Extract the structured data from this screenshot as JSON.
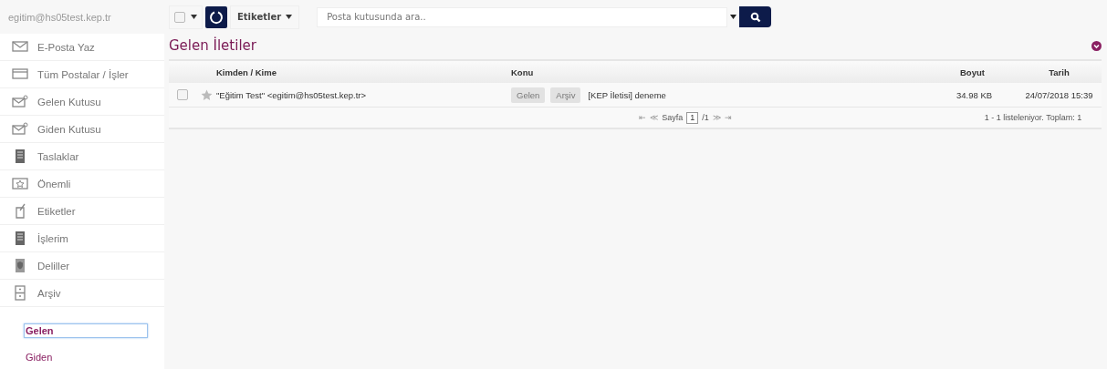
{
  "account": "egitim@hs05test.kep.tr",
  "sidebar": {
    "items": [
      {
        "label": "E-Posta Yaz"
      },
      {
        "label": "Tüm Postalar / İşler"
      },
      {
        "label": "Gelen Kutusu"
      },
      {
        "label": "Giden Kutusu"
      },
      {
        "label": "Taslaklar"
      },
      {
        "label": "Önemli"
      },
      {
        "label": "Etiketler"
      },
      {
        "label": "İşlerim"
      },
      {
        "label": "Deliller"
      },
      {
        "label": "Arşiv"
      }
    ],
    "folders": [
      {
        "label": "Gelen",
        "selected": true
      },
      {
        "label": "Giden",
        "selected": false
      }
    ]
  },
  "toolbar": {
    "select_all": {
      "checked": false
    },
    "labels_button": "Etiketler",
    "search": {
      "placeholder": "Posta kutusunda ara.."
    }
  },
  "title": "Gelen İletiler",
  "table": {
    "columns": [
      "Kimden / Kime",
      "Konu",
      "Boyut",
      "Tarih"
    ],
    "rows": [
      {
        "checked": false,
        "starred": false,
        "from": "\"Eğitim Test\" <egitim@hs05test.kep.tr>",
        "tags": [
          "Gelen",
          "Arşiv"
        ],
        "subject": "[KEP İletisi] deneme",
        "size": "34.98 KB",
        "date": "24/07/2018 15:39"
      }
    ]
  },
  "pager": {
    "first": "⇤",
    "prev": "≪",
    "label": "Sayfa",
    "page": "1",
    "total": "/1",
    "next": "≫",
    "last": "⇥",
    "summary": "1 - 1 listeleniyor. Toplam: 1"
  }
}
